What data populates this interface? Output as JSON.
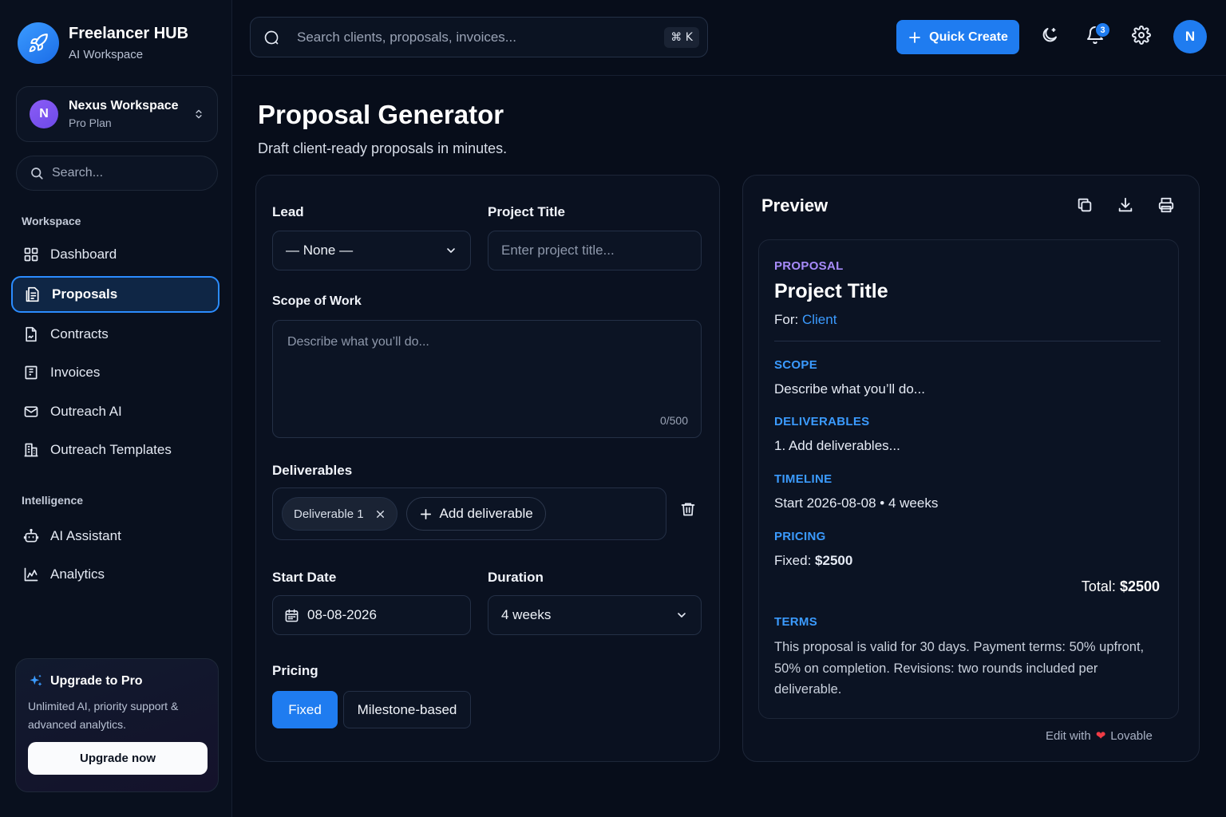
{
  "brand": {
    "name": "Freelancer HUB",
    "subtitle": "AI Workspace",
    "logo_icon": "rocket-icon"
  },
  "workspace": {
    "initial": "N",
    "name": "Nexus Workspace",
    "plan": "Pro Plan"
  },
  "sidebar": {
    "search_placeholder": "Search...",
    "sections": [
      {
        "label": "Workspace"
      },
      {
        "label": "Intelligence"
      }
    ],
    "items": [
      {
        "label": "Dashboard",
        "icon": "grid-icon"
      },
      {
        "label": "Proposals",
        "icon": "document-icon",
        "active": true
      },
      {
        "label": "Contracts",
        "icon": "file-signature-icon"
      },
      {
        "label": "Invoices",
        "icon": "receipt-icon"
      },
      {
        "label": "Outreach AI",
        "icon": "mail-icon"
      },
      {
        "label": "Outreach Templates",
        "icon": "building-icon"
      },
      {
        "label": "AI Assistant",
        "icon": "bot-icon"
      },
      {
        "label": "Analytics",
        "icon": "chart-icon"
      }
    ],
    "upgrade": {
      "title": "Upgrade to Pro",
      "description": "Unlimited AI, priority support & advanced analytics.",
      "button": "Upgrade now"
    }
  },
  "topbar": {
    "search_placeholder": "Search clients, proposals, invoices...",
    "shortcut": "⌘ K",
    "quick_create": "Quick Create",
    "notification_count": "3",
    "user_initial": "N"
  },
  "page": {
    "title": "Proposal Generator",
    "subtitle": "Draft client-ready proposals in minutes."
  },
  "form": {
    "lead_label": "Lead",
    "lead_value": "— None —",
    "project_title_label": "Project Title",
    "project_title_placeholder": "Enter project title...",
    "scope_label": "Scope of Work",
    "scope_placeholder": "Describe what you’ll do...",
    "char_count": "0/500",
    "deliverables_label": "Deliverables",
    "deliverable_chip": "Deliverable 1",
    "add_deliverable": "Add deliverable",
    "start_date_label": "Start Date",
    "start_date_value": "08-08-2026",
    "duration_label": "Duration",
    "duration_value": "4 weeks",
    "pricing_label": "Pricing",
    "pricing_options": [
      "Fixed",
      "Milestone-based"
    ],
    "pricing_selected": "Fixed"
  },
  "preview": {
    "title": "Preview",
    "eyebrow": "PROPOSAL",
    "doc_title": "Project Title",
    "for_label": "For:",
    "client": "Client",
    "scope_heading": "SCOPE",
    "scope_text": "Describe what you’ll do...",
    "deliverables_heading": "DELIVERABLES",
    "deliverables_text": "1. Add deliverables...",
    "timeline_heading": "TIMELINE",
    "timeline_text": "Start 2026-08-08 • 4 weeks",
    "pricing_heading": "PRICING",
    "pricing_label": "Fixed:",
    "pricing_amount": "$2500",
    "total_label": "Total:",
    "total_amount": "$2500",
    "terms_heading": "TERMS",
    "terms_text": "This proposal is valid for 30 days. Payment terms: 50% upfront, 50% on completion. Revisions: two rounds included per deliverable.",
    "footer_prefix": "Edit with",
    "footer_brand": "Lovable"
  },
  "colors": {
    "accent": "#1f7cf0",
    "purple_label": "#a78bfa",
    "blue_label": "#3b9bff",
    "background": "#070d1a"
  }
}
